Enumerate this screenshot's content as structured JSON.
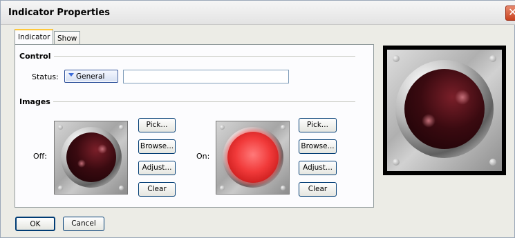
{
  "window": {
    "title": "Indicator Properties"
  },
  "tabs": [
    {
      "label": "Indicator"
    },
    {
      "label": "Show"
    }
  ],
  "control": {
    "section_title": "Control",
    "status_label": "Status:",
    "status_value": "General",
    "status_text_value": ""
  },
  "images": {
    "section_title": "Images",
    "off": {
      "label": "Off:",
      "pick": "Pick...",
      "browse": "Browse...",
      "adjust": "Adjust...",
      "clear": "Clear"
    },
    "on": {
      "label": "On:",
      "pick": "Pick...",
      "browse": "Browse...",
      "adjust": "Adjust...",
      "clear": "Clear"
    }
  },
  "footer": {
    "ok": "OK",
    "cancel": "Cancel"
  },
  "icons": {
    "close": "close-icon",
    "dropdown": "dropdown-arrow-icon"
  },
  "colors": {
    "accent_tab": "#ffc83c",
    "button_border": "#003c74",
    "led_on": "#f13a3a",
    "led_off": "#3a0a10"
  }
}
